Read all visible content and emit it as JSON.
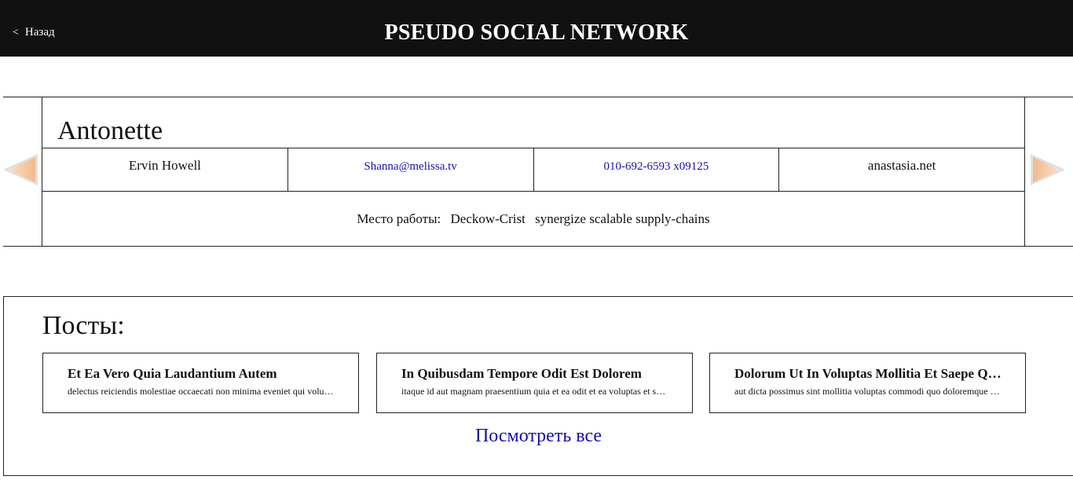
{
  "header": {
    "back_label": "Назад",
    "back_icon": "chevron-left-icon",
    "title": "PSEUDO SOCIAL NETWORK"
  },
  "profile": {
    "username": "Antonette",
    "name": "Ervin Howell",
    "email": "Shanna@melissa.tv",
    "phone": "010-692-6593 x09125",
    "website": "anastasia.net",
    "work_label": "Место работы:",
    "company_name": "Deckow-Crist",
    "company_catchphrase": "synergize scalable supply-chains",
    "prev_icon": "arrow-left-icon",
    "next_icon": "arrow-right-icon"
  },
  "posts": {
    "title": "Посты:",
    "items": [
      {
        "title": "Et Ea Vero Quia Laudantium Autem",
        "body": "delectus reiciendis molestiae occaecati non minima eveniet qui voluptatibus"
      },
      {
        "title": "In Quibusdam Tempore Odit Est Dolorem",
        "body": "itaque id aut magnam praesentium quia et ea odit et ea voluptas et sapiente"
      },
      {
        "title": "Dolorum Ut In Voluptas Mollitia Et Saepe Quo Animi",
        "body": "aut dicta possimus sint mollitia voluptas commodi quo doloremque iste corrupti"
      }
    ],
    "see_all_label": "Посмотреть все"
  },
  "colors": {
    "header_bg": "#111111",
    "link": "#1a0dab",
    "arrow_fill": "#f6c9a0"
  }
}
